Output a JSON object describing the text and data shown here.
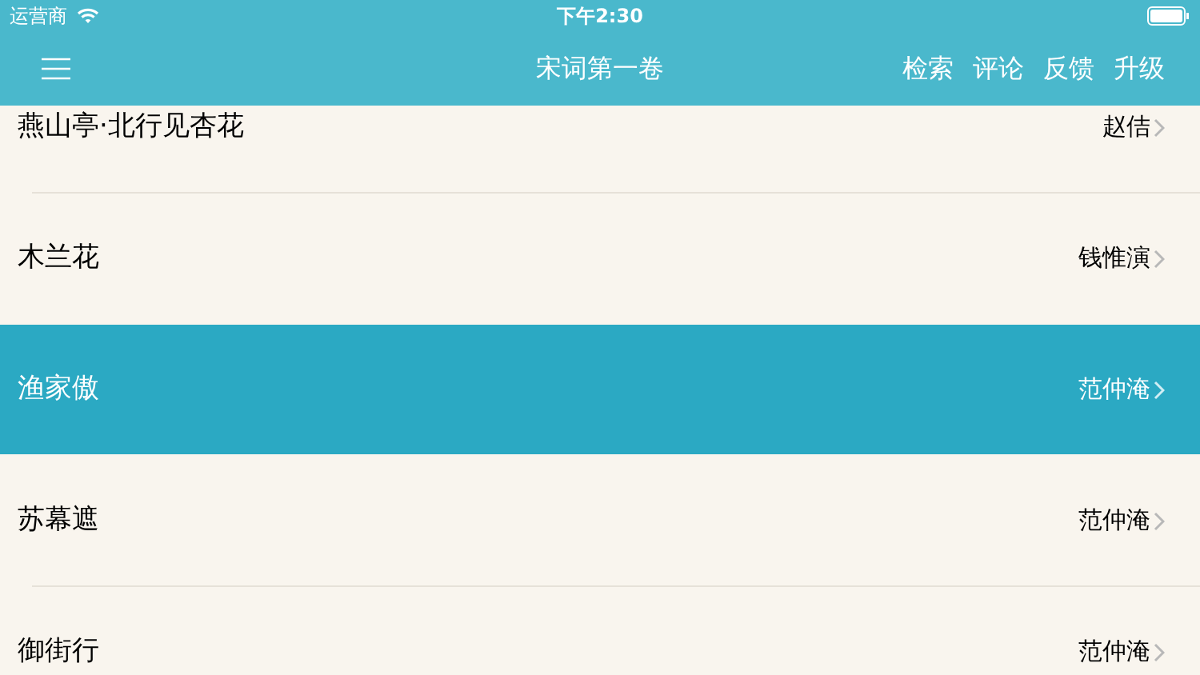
{
  "status_bar": {
    "carrier": "运营商",
    "time": "下午2:30"
  },
  "nav_bar": {
    "title": "宋词第一卷",
    "actions": [
      "检索",
      "评论",
      "反馈",
      "升级"
    ]
  },
  "rows": [
    {
      "title": "燕山亭·北行见杏花",
      "author": "赵佶",
      "selected": false
    },
    {
      "title": "木兰花",
      "author": "钱惟演",
      "selected": false
    },
    {
      "title": "渔家傲",
      "author": "范仲淹",
      "selected": true
    },
    {
      "title": "苏幕遮",
      "author": "范仲淹",
      "selected": false
    },
    {
      "title": "御街行",
      "author": "范仲淹",
      "selected": false
    }
  ]
}
